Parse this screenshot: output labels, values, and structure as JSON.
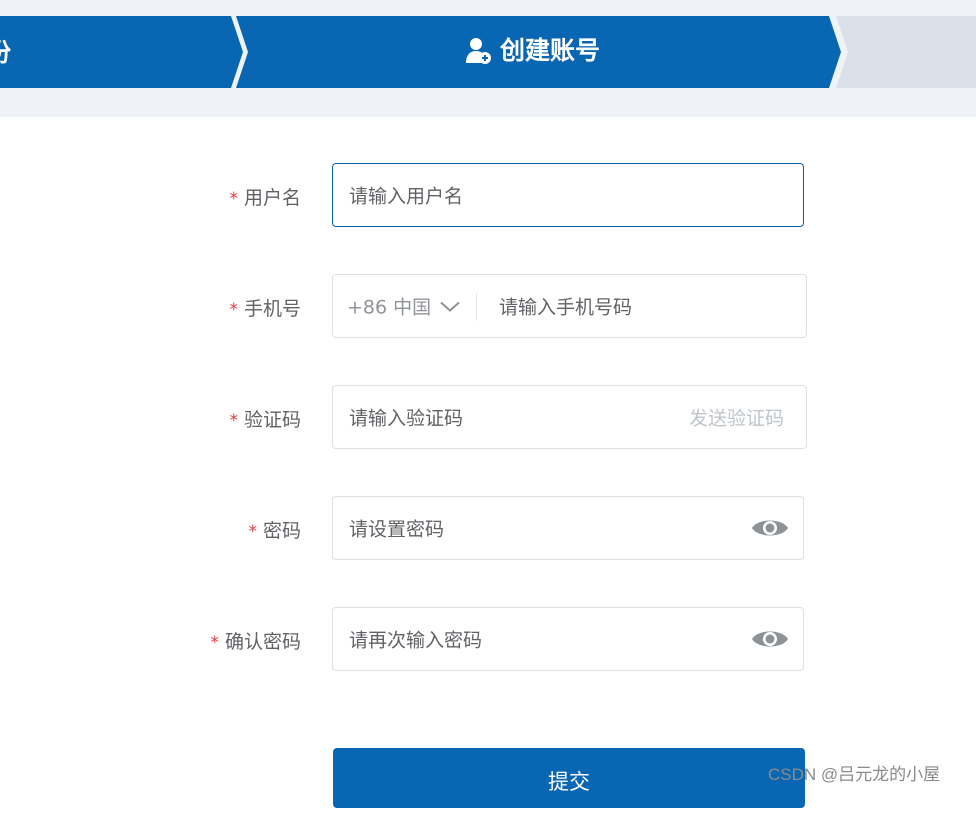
{
  "steps": {
    "previous_label": "份",
    "current_label": "创建账号"
  },
  "form": {
    "username": {
      "label": "用户名",
      "placeholder": "请输入用户名"
    },
    "phone": {
      "label": "手机号",
      "country": "+86 中国",
      "placeholder": "请输入手机号码"
    },
    "code": {
      "label": "验证码",
      "placeholder": "请输入验证码",
      "send_label": "发送验证码"
    },
    "password": {
      "label": "密码",
      "placeholder": "请设置密码"
    },
    "confirm": {
      "label": "确认密码",
      "placeholder": "请再次输入密码"
    },
    "required_mark": "*",
    "submit_label": "提交"
  },
  "watermark": "CSDN @吕元龙的小屋",
  "icons": {
    "current_step": "user-plus-icon",
    "dropdown": "chevron-down-icon",
    "password_toggle": "eye-icon"
  },
  "colors": {
    "primary": "#0866b3",
    "step_inactive": "#dce0e8",
    "band": "#eff3f7",
    "required": "#e23b3b",
    "focus_border": "#0f5fa5"
  }
}
